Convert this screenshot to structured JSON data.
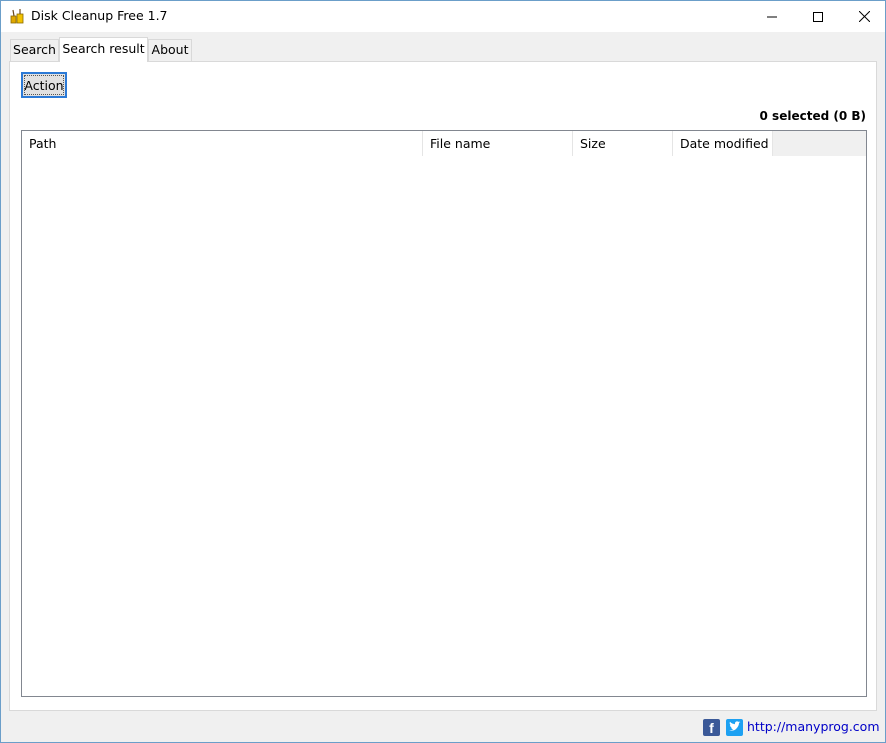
{
  "window": {
    "title": "Disk Cleanup Free 1.7"
  },
  "tabs": [
    {
      "label": "Search"
    },
    {
      "label": "Search result"
    },
    {
      "label": "About"
    }
  ],
  "results": {
    "action_label": "Action",
    "selected_info": "0 selected (0 B)",
    "columns": [
      "Path",
      "File name",
      "Size",
      "Date modified"
    ],
    "rows": []
  },
  "footer": {
    "facebook_letter": "f",
    "link_text": "http://manyprog.com"
  },
  "colors": {
    "accent": "#2c7ad6",
    "facebook": "#3b5998",
    "twitter": "#1da1f2",
    "link": "#0000c8"
  }
}
